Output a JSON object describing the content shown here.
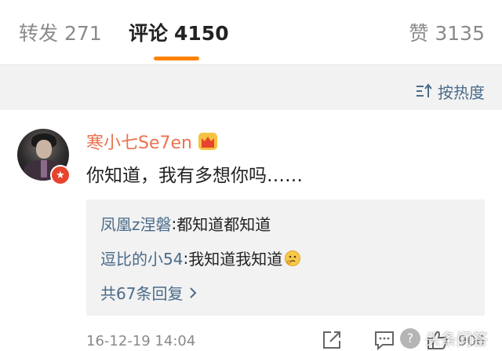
{
  "tabs": {
    "repost": {
      "label": "转发",
      "count": "271"
    },
    "comment": {
      "label": "评论",
      "count": "4150"
    },
    "like": {
      "label": "赞",
      "count": "3135"
    }
  },
  "sort": {
    "label": "按热度",
    "icon": "sort-icon"
  },
  "comment": {
    "username": "寒小七Se7en",
    "text": "你知道，我有多想你吗……",
    "timestamp": "16-12-19 14:04",
    "like_count": "906",
    "replies": [
      {
        "user": "凤凰z涅磐",
        "sep": ": ",
        "text": "都知道都知道"
      },
      {
        "user": "逗比的小54",
        "sep": ": ",
        "text": "我知道我知道"
      }
    ],
    "more_replies": "共67条回复"
  },
  "watermark": {
    "text": "头条问答"
  },
  "colors": {
    "accent": "#ff8200",
    "username": "#eb7350",
    "link": "#4a6b8a",
    "verified": "#e8432e"
  }
}
